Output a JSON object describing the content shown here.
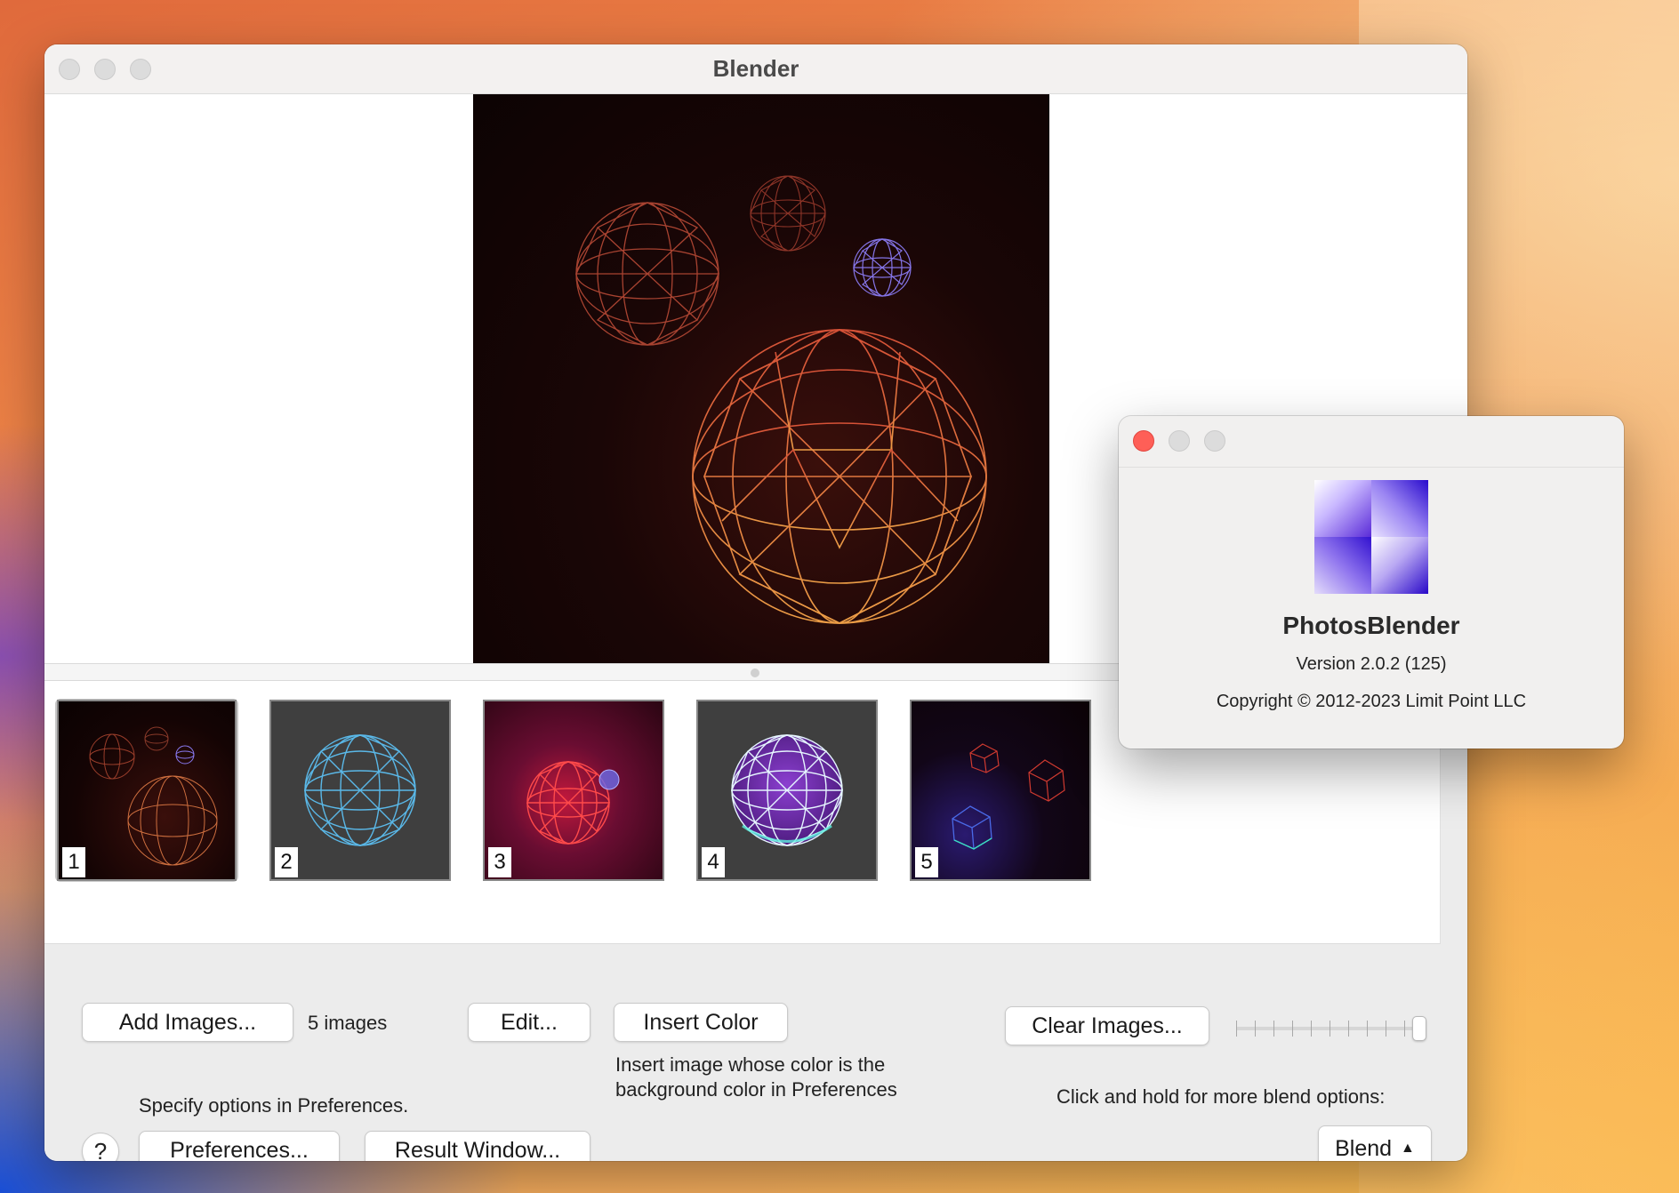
{
  "main_window": {
    "title": "Blender",
    "thumbnails": [
      {
        "number": "1",
        "theme": "dark-red wireframe spheres",
        "selected": true
      },
      {
        "number": "2",
        "theme": "blue wireframe sphere on gray"
      },
      {
        "number": "3",
        "theme": "red sphere on magenta"
      },
      {
        "number": "4",
        "theme": "purple-cyan sphere on gray"
      },
      {
        "number": "5",
        "theme": "red and blue icosahedrons on dark"
      }
    ],
    "controls": {
      "add_images_label": "Add Images...",
      "image_count": "5 images",
      "edit_label": "Edit...",
      "insert_color_label": "Insert Color",
      "insert_color_help_line1": "Insert image whose color is the",
      "insert_color_help_line2": "background color in Preferences",
      "clear_images_label": "Clear Images...",
      "options_hint": "Specify options in Preferences.",
      "help_label": "?",
      "preferences_label": "Preferences...",
      "result_window_label": "Result Window...",
      "blend_hint": "Click and hold for more blend options:",
      "blend_label": "Blend",
      "blend_arrow": "▲"
    }
  },
  "about_window": {
    "app_name": "PhotosBlender",
    "version": "Version 2.0.2 (125)",
    "copyright": "Copyright © 2012-2023 Limit Point LLC"
  },
  "colors": {
    "close_red": "#fe5f57",
    "icon_accent": "#3312d0",
    "sphere_orange": "#f08a4a"
  }
}
